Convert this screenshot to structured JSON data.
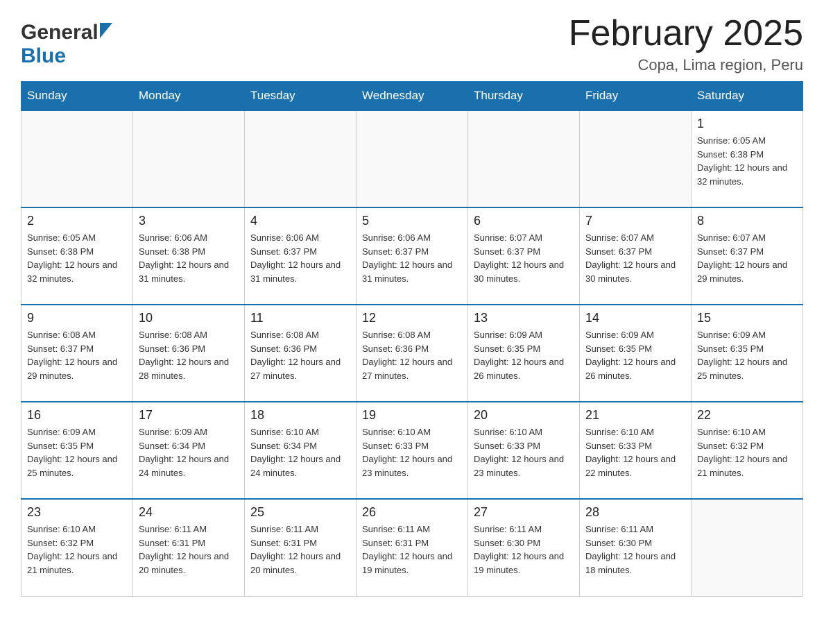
{
  "header": {
    "logo_general": "General",
    "logo_blue": "Blue",
    "month_title": "February 2025",
    "location": "Copa, Lima region, Peru"
  },
  "weekdays": [
    "Sunday",
    "Monday",
    "Tuesday",
    "Wednesday",
    "Thursday",
    "Friday",
    "Saturday"
  ],
  "weeks": [
    [
      {
        "day": "",
        "sunrise": "",
        "sunset": "",
        "daylight": ""
      },
      {
        "day": "",
        "sunrise": "",
        "sunset": "",
        "daylight": ""
      },
      {
        "day": "",
        "sunrise": "",
        "sunset": "",
        "daylight": ""
      },
      {
        "day": "",
        "sunrise": "",
        "sunset": "",
        "daylight": ""
      },
      {
        "day": "",
        "sunrise": "",
        "sunset": "",
        "daylight": ""
      },
      {
        "day": "",
        "sunrise": "",
        "sunset": "",
        "daylight": ""
      },
      {
        "day": "1",
        "sunrise": "Sunrise: 6:05 AM",
        "sunset": "Sunset: 6:38 PM",
        "daylight": "Daylight: 12 hours and 32 minutes."
      }
    ],
    [
      {
        "day": "2",
        "sunrise": "Sunrise: 6:05 AM",
        "sunset": "Sunset: 6:38 PM",
        "daylight": "Daylight: 12 hours and 32 minutes."
      },
      {
        "day": "3",
        "sunrise": "Sunrise: 6:06 AM",
        "sunset": "Sunset: 6:38 PM",
        "daylight": "Daylight: 12 hours and 31 minutes."
      },
      {
        "day": "4",
        "sunrise": "Sunrise: 6:06 AM",
        "sunset": "Sunset: 6:37 PM",
        "daylight": "Daylight: 12 hours and 31 minutes."
      },
      {
        "day": "5",
        "sunrise": "Sunrise: 6:06 AM",
        "sunset": "Sunset: 6:37 PM",
        "daylight": "Daylight: 12 hours and 31 minutes."
      },
      {
        "day": "6",
        "sunrise": "Sunrise: 6:07 AM",
        "sunset": "Sunset: 6:37 PM",
        "daylight": "Daylight: 12 hours and 30 minutes."
      },
      {
        "day": "7",
        "sunrise": "Sunrise: 6:07 AM",
        "sunset": "Sunset: 6:37 PM",
        "daylight": "Daylight: 12 hours and 30 minutes."
      },
      {
        "day": "8",
        "sunrise": "Sunrise: 6:07 AM",
        "sunset": "Sunset: 6:37 PM",
        "daylight": "Daylight: 12 hours and 29 minutes."
      }
    ],
    [
      {
        "day": "9",
        "sunrise": "Sunrise: 6:08 AM",
        "sunset": "Sunset: 6:37 PM",
        "daylight": "Daylight: 12 hours and 29 minutes."
      },
      {
        "day": "10",
        "sunrise": "Sunrise: 6:08 AM",
        "sunset": "Sunset: 6:36 PM",
        "daylight": "Daylight: 12 hours and 28 minutes."
      },
      {
        "day": "11",
        "sunrise": "Sunrise: 6:08 AM",
        "sunset": "Sunset: 6:36 PM",
        "daylight": "Daylight: 12 hours and 27 minutes."
      },
      {
        "day": "12",
        "sunrise": "Sunrise: 6:08 AM",
        "sunset": "Sunset: 6:36 PM",
        "daylight": "Daylight: 12 hours and 27 minutes."
      },
      {
        "day": "13",
        "sunrise": "Sunrise: 6:09 AM",
        "sunset": "Sunset: 6:35 PM",
        "daylight": "Daylight: 12 hours and 26 minutes."
      },
      {
        "day": "14",
        "sunrise": "Sunrise: 6:09 AM",
        "sunset": "Sunset: 6:35 PM",
        "daylight": "Daylight: 12 hours and 26 minutes."
      },
      {
        "day": "15",
        "sunrise": "Sunrise: 6:09 AM",
        "sunset": "Sunset: 6:35 PM",
        "daylight": "Daylight: 12 hours and 25 minutes."
      }
    ],
    [
      {
        "day": "16",
        "sunrise": "Sunrise: 6:09 AM",
        "sunset": "Sunset: 6:35 PM",
        "daylight": "Daylight: 12 hours and 25 minutes."
      },
      {
        "day": "17",
        "sunrise": "Sunrise: 6:09 AM",
        "sunset": "Sunset: 6:34 PM",
        "daylight": "Daylight: 12 hours and 24 minutes."
      },
      {
        "day": "18",
        "sunrise": "Sunrise: 6:10 AM",
        "sunset": "Sunset: 6:34 PM",
        "daylight": "Daylight: 12 hours and 24 minutes."
      },
      {
        "day": "19",
        "sunrise": "Sunrise: 6:10 AM",
        "sunset": "Sunset: 6:33 PM",
        "daylight": "Daylight: 12 hours and 23 minutes."
      },
      {
        "day": "20",
        "sunrise": "Sunrise: 6:10 AM",
        "sunset": "Sunset: 6:33 PM",
        "daylight": "Daylight: 12 hours and 23 minutes."
      },
      {
        "day": "21",
        "sunrise": "Sunrise: 6:10 AM",
        "sunset": "Sunset: 6:33 PM",
        "daylight": "Daylight: 12 hours and 22 minutes."
      },
      {
        "day": "22",
        "sunrise": "Sunrise: 6:10 AM",
        "sunset": "Sunset: 6:32 PM",
        "daylight": "Daylight: 12 hours and 21 minutes."
      }
    ],
    [
      {
        "day": "23",
        "sunrise": "Sunrise: 6:10 AM",
        "sunset": "Sunset: 6:32 PM",
        "daylight": "Daylight: 12 hours and 21 minutes."
      },
      {
        "day": "24",
        "sunrise": "Sunrise: 6:11 AM",
        "sunset": "Sunset: 6:31 PM",
        "daylight": "Daylight: 12 hours and 20 minutes."
      },
      {
        "day": "25",
        "sunrise": "Sunrise: 6:11 AM",
        "sunset": "Sunset: 6:31 PM",
        "daylight": "Daylight: 12 hours and 20 minutes."
      },
      {
        "day": "26",
        "sunrise": "Sunrise: 6:11 AM",
        "sunset": "Sunset: 6:31 PM",
        "daylight": "Daylight: 12 hours and 19 minutes."
      },
      {
        "day": "27",
        "sunrise": "Sunrise: 6:11 AM",
        "sunset": "Sunset: 6:30 PM",
        "daylight": "Daylight: 12 hours and 19 minutes."
      },
      {
        "day": "28",
        "sunrise": "Sunrise: 6:11 AM",
        "sunset": "Sunset: 6:30 PM",
        "daylight": "Daylight: 12 hours and 18 minutes."
      },
      {
        "day": "",
        "sunrise": "",
        "sunset": "",
        "daylight": ""
      }
    ]
  ]
}
